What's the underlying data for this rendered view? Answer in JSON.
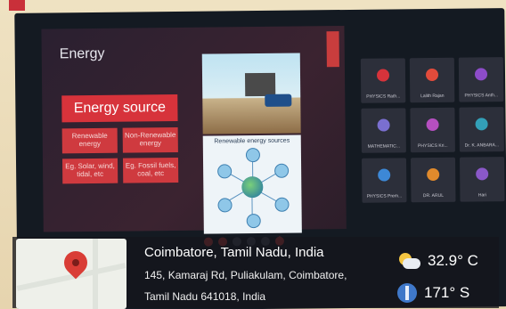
{
  "slide": {
    "title": "Energy",
    "source_box": "Energy source",
    "renewable": "Renewable energy",
    "non_renewable": "Non-Renewable energy",
    "renewable_eg": "Eg. Solar, wind, tidal, etc",
    "non_renewable_eg": "Eg. Fossil fuels, coal, etc",
    "diagram_title": "Renewable energy sources"
  },
  "participants": [
    {
      "name": "PHYSICS Rath...",
      "color": "#d7333b"
    },
    {
      "name": "Lalith Rajan",
      "color": "#e24b3b"
    },
    {
      "name": "PHYSICS Anth...",
      "color": "#8d4cc9"
    },
    {
      "name": "MATHEMATIC...",
      "color": "#7a6fd0"
    },
    {
      "name": "PHYSICS Kri...",
      "color": "#b54fc0"
    },
    {
      "name": "Dr. K. ANBARA...",
      "color": "#33a0b8"
    },
    {
      "name": "PHYSICS Prem...",
      "color": "#3d88d6"
    },
    {
      "name": "DR. ARUL",
      "color": "#e08a2c"
    },
    {
      "name": "Hari",
      "color": "#8a58c8"
    }
  ],
  "location": {
    "title": "Coimbatore, Tamil Nadu, India",
    "line1": "145, Kamaraj Rd, Puliakulam, Coimbatore,",
    "line2": "Tamil Nadu 641018, India"
  },
  "weather": {
    "temperature": "32.9° C",
    "wind": "171° S",
    "icon": "partly-cloudy-icon",
    "wind_icon": "compass-icon"
  },
  "colors": {
    "accent_red": "#d7333b",
    "pin_red": "#d93d36"
  }
}
